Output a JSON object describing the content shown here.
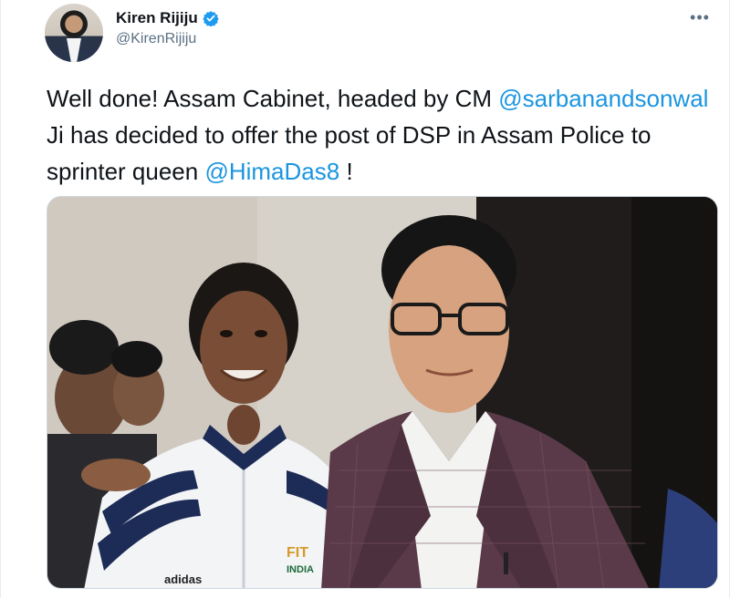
{
  "tweet": {
    "author": {
      "display_name": "Kiren Rijiju",
      "handle": "@KirenRijiju",
      "verified": true
    },
    "more_icon": "more-options-icon",
    "text_segments": [
      {
        "text": "Well done! Assam Cabinet, headed by CM ",
        "type": "text"
      },
      {
        "text": "@sarbanandsonwal",
        "type": "mention"
      },
      {
        "text": " Ji has decided to offer the post of DSP in Assam Police to sprinter queen ",
        "type": "text"
      },
      {
        "text": "@HimaDas8",
        "type": "mention"
      },
      {
        "text": " !",
        "type": "text"
      }
    ],
    "image": {
      "subject": "photo of athlete and official posing together",
      "jacket_text_1": "FIT",
      "jacket_text_2": "INDIA",
      "logo_text": "adidas"
    }
  },
  "colors": {
    "mention": "#1b95e0",
    "verified_badge": "#1d9bf0",
    "secondary_text": "#5b7083"
  }
}
